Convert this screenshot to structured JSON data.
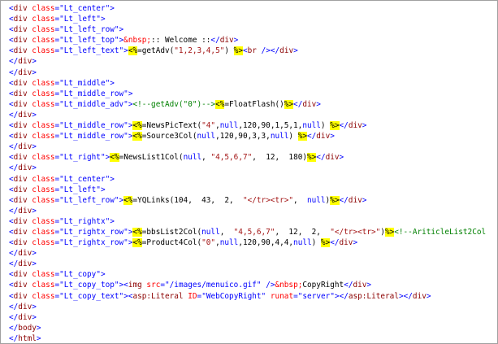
{
  "colors": {
    "tag": "#8b0000",
    "bracket": "#0000ff",
    "attribute": "#ff0000",
    "string": "#0000ff",
    "entity": "#ff0000",
    "comment": "#008000",
    "asp_delimiter_bg": "#ffff00"
  },
  "lines": [
    [
      [
        "brk",
        "<"
      ],
      [
        "tag",
        "div"
      ],
      [
        "text",
        " "
      ],
      [
        "attr",
        "class"
      ],
      [
        "eq",
        "="
      ],
      [
        "str",
        "\"Lt_center\""
      ],
      [
        "brk",
        ">"
      ]
    ],
    [
      [
        "brk",
        "<"
      ],
      [
        "tag",
        "div"
      ],
      [
        "text",
        " "
      ],
      [
        "attr",
        "class"
      ],
      [
        "eq",
        "="
      ],
      [
        "str",
        "\"Lt_left\""
      ],
      [
        "brk",
        ">"
      ]
    ],
    [
      [
        "brk",
        "<"
      ],
      [
        "tag",
        "div"
      ],
      [
        "text",
        " "
      ],
      [
        "attr",
        "class"
      ],
      [
        "eq",
        "="
      ],
      [
        "str",
        "\"Lt_left_row\""
      ],
      [
        "brk",
        ">"
      ]
    ],
    [
      [
        "brk",
        "<"
      ],
      [
        "tag",
        "div"
      ],
      [
        "text",
        " "
      ],
      [
        "attr",
        "class"
      ],
      [
        "eq",
        "="
      ],
      [
        "str",
        "\"Lt_left_top\""
      ],
      [
        "brk",
        ">"
      ],
      [
        "ent",
        "&nbsp;"
      ],
      [
        "text",
        ":: Welcome ::"
      ],
      [
        "brk",
        "</"
      ],
      [
        "tag",
        "div"
      ],
      [
        "brk",
        ">"
      ]
    ],
    [
      [
        "brk",
        "<"
      ],
      [
        "tag",
        "div"
      ],
      [
        "text",
        " "
      ],
      [
        "attr",
        "class"
      ],
      [
        "eq",
        "="
      ],
      [
        "str",
        "\"Lt_left_text\""
      ],
      [
        "brk",
        ">"
      ],
      [
        "asp",
        "<%"
      ],
      [
        "code",
        "=getAdv("
      ],
      [
        "cstr",
        "\"1,2,3,4,5\""
      ],
      [
        "code",
        ") "
      ],
      [
        "asp",
        "%>"
      ],
      [
        "brk",
        "<"
      ],
      [
        "tag",
        "br"
      ],
      [
        "text",
        " "
      ],
      [
        "brk",
        "/>"
      ],
      [
        "brk",
        "</"
      ],
      [
        "tag",
        "div"
      ],
      [
        "brk",
        ">"
      ]
    ],
    [
      [
        "brk",
        "</"
      ],
      [
        "tag",
        "div"
      ],
      [
        "brk",
        ">"
      ]
    ],
    [
      [
        "brk",
        "</"
      ],
      [
        "tag",
        "div"
      ],
      [
        "brk",
        ">"
      ]
    ],
    [
      [
        "brk",
        "<"
      ],
      [
        "tag",
        "div"
      ],
      [
        "text",
        " "
      ],
      [
        "attr",
        "class"
      ],
      [
        "eq",
        "="
      ],
      [
        "str",
        "\"Lt_middle\""
      ],
      [
        "brk",
        ">"
      ]
    ],
    [
      [
        "brk",
        "<"
      ],
      [
        "tag",
        "div"
      ],
      [
        "text",
        " "
      ],
      [
        "attr",
        "class"
      ],
      [
        "eq",
        "="
      ],
      [
        "str",
        "\"Lt_middle_row\""
      ],
      [
        "brk",
        ">"
      ]
    ],
    [
      [
        "brk",
        "<"
      ],
      [
        "tag",
        "div"
      ],
      [
        "text",
        " "
      ],
      [
        "attr",
        "class"
      ],
      [
        "eq",
        "="
      ],
      [
        "str",
        "\"Lt_middle_adv\""
      ],
      [
        "brk",
        ">"
      ],
      [
        "cmt",
        "<!--getAdv(\"0\")-->"
      ],
      [
        "asp",
        "<%"
      ],
      [
        "code",
        "=FloatFlash()"
      ],
      [
        "asp",
        "%>"
      ],
      [
        "brk",
        "</"
      ],
      [
        "tag",
        "div"
      ],
      [
        "brk",
        ">"
      ]
    ],
    [
      [
        "brk",
        "</"
      ],
      [
        "tag",
        "div"
      ],
      [
        "brk",
        ">"
      ]
    ],
    [
      [
        "brk",
        "<"
      ],
      [
        "tag",
        "div"
      ],
      [
        "text",
        " "
      ],
      [
        "attr",
        "class"
      ],
      [
        "eq",
        "="
      ],
      [
        "str",
        "\"Lt_middle_row\""
      ],
      [
        "brk",
        ">"
      ],
      [
        "asp",
        "<%"
      ],
      [
        "code",
        "=NewsPicText("
      ],
      [
        "cstr",
        "\"4\""
      ],
      [
        "code",
        ","
      ],
      [
        "kw",
        "null"
      ],
      [
        "code",
        ",120,90,1,5,1,"
      ],
      [
        "kw",
        "null"
      ],
      [
        "code",
        ") "
      ],
      [
        "asp",
        "%>"
      ],
      [
        "brk",
        "</"
      ],
      [
        "tag",
        "div"
      ],
      [
        "brk",
        ">"
      ]
    ],
    [
      [
        "brk",
        "<"
      ],
      [
        "tag",
        "div"
      ],
      [
        "text",
        " "
      ],
      [
        "attr",
        "class"
      ],
      [
        "eq",
        "="
      ],
      [
        "str",
        "\"Lt_middle_row\""
      ],
      [
        "brk",
        ">"
      ],
      [
        "asp",
        "<%"
      ],
      [
        "code",
        "=Source3Col("
      ],
      [
        "kw",
        "null"
      ],
      [
        "code",
        ",120,90,3,3,"
      ],
      [
        "kw",
        "null"
      ],
      [
        "code",
        ") "
      ],
      [
        "asp",
        "%>"
      ],
      [
        "brk",
        "</"
      ],
      [
        "tag",
        "div"
      ],
      [
        "brk",
        ">"
      ]
    ],
    [
      [
        "brk",
        "</"
      ],
      [
        "tag",
        "div"
      ],
      [
        "brk",
        ">"
      ]
    ],
    [
      [
        "brk",
        "<"
      ],
      [
        "tag",
        "div"
      ],
      [
        "text",
        " "
      ],
      [
        "attr",
        "class"
      ],
      [
        "eq",
        "="
      ],
      [
        "str",
        "\"Lt_right\""
      ],
      [
        "brk",
        ">"
      ],
      [
        "asp",
        "<%"
      ],
      [
        "code",
        "=NewsList1Col("
      ],
      [
        "kw",
        "null"
      ],
      [
        "code",
        ", "
      ],
      [
        "cstr",
        "\"4,5,6,7\""
      ],
      [
        "code",
        ",  12,  180)"
      ],
      [
        "asp",
        "%>"
      ],
      [
        "brk",
        "</"
      ],
      [
        "tag",
        "div"
      ],
      [
        "brk",
        ">"
      ]
    ],
    [
      [
        "brk",
        "</"
      ],
      [
        "tag",
        "div"
      ],
      [
        "brk",
        ">"
      ]
    ],
    [
      [
        "brk",
        "<"
      ],
      [
        "tag",
        "div"
      ],
      [
        "text",
        " "
      ],
      [
        "attr",
        "class"
      ],
      [
        "eq",
        "="
      ],
      [
        "str",
        "\"Lt_center\""
      ],
      [
        "brk",
        ">"
      ]
    ],
    [
      [
        "brk",
        "<"
      ],
      [
        "tag",
        "div"
      ],
      [
        "text",
        " "
      ],
      [
        "attr",
        "class"
      ],
      [
        "eq",
        "="
      ],
      [
        "str",
        "\"Lt_left\""
      ],
      [
        "brk",
        ">"
      ]
    ],
    [
      [
        "brk",
        "<"
      ],
      [
        "tag",
        "div"
      ],
      [
        "text",
        " "
      ],
      [
        "attr",
        "class"
      ],
      [
        "eq",
        "="
      ],
      [
        "str",
        "\"Lt_left_row\""
      ],
      [
        "brk",
        ">"
      ],
      [
        "asp",
        "<%"
      ],
      [
        "code",
        "=YQLinks(104,  43,  2,  "
      ],
      [
        "cstr",
        "\"</tr><tr>\""
      ],
      [
        "code",
        ",  "
      ],
      [
        "kw",
        "null"
      ],
      [
        "code",
        ")"
      ],
      [
        "asp",
        "%>"
      ],
      [
        "brk",
        "</"
      ],
      [
        "tag",
        "div"
      ],
      [
        "brk",
        ">"
      ]
    ],
    [
      [
        "brk",
        "</"
      ],
      [
        "tag",
        "div"
      ],
      [
        "brk",
        ">"
      ]
    ],
    [
      [
        "brk",
        "<"
      ],
      [
        "tag",
        "div"
      ],
      [
        "text",
        " "
      ],
      [
        "attr",
        "class"
      ],
      [
        "eq",
        "="
      ],
      [
        "str",
        "\"Lt_rightx\""
      ],
      [
        "brk",
        ">"
      ]
    ],
    [
      [
        "brk",
        "<"
      ],
      [
        "tag",
        "div"
      ],
      [
        "text",
        " "
      ],
      [
        "attr",
        "class"
      ],
      [
        "eq",
        "="
      ],
      [
        "str",
        "\"Lt_rightx_row\""
      ],
      [
        "brk",
        ">"
      ],
      [
        "asp",
        "<%"
      ],
      [
        "code",
        "=bbsList2Col("
      ],
      [
        "kw",
        "null"
      ],
      [
        "code",
        ",  "
      ],
      [
        "cstr",
        "\"4,5,6,7\""
      ],
      [
        "code",
        ",  12,  2,  "
      ],
      [
        "cstr",
        "\"</tr><tr>\""
      ],
      [
        "code",
        ")"
      ],
      [
        "asp",
        "%>"
      ],
      [
        "cmt",
        "<!--AriticleList2Col"
      ]
    ],
    [
      [
        "brk",
        "<"
      ],
      [
        "tag",
        "div"
      ],
      [
        "text",
        " "
      ],
      [
        "attr",
        "class"
      ],
      [
        "eq",
        "="
      ],
      [
        "str",
        "\"Lt_rightx_row\""
      ],
      [
        "brk",
        ">"
      ],
      [
        "asp",
        "<%"
      ],
      [
        "code",
        "=Product4Col("
      ],
      [
        "cstr",
        "\"0\""
      ],
      [
        "code",
        ","
      ],
      [
        "kw",
        "null"
      ],
      [
        "code",
        ",120,90,4,4,"
      ],
      [
        "kw",
        "null"
      ],
      [
        "code",
        ") "
      ],
      [
        "asp",
        "%>"
      ],
      [
        "brk",
        "</"
      ],
      [
        "tag",
        "div"
      ],
      [
        "brk",
        ">"
      ]
    ],
    [
      [
        "brk",
        "</"
      ],
      [
        "tag",
        "div"
      ],
      [
        "brk",
        ">"
      ]
    ],
    [
      [
        "brk",
        "</"
      ],
      [
        "tag",
        "div"
      ],
      [
        "brk",
        ">"
      ]
    ],
    [
      [
        "brk",
        "<"
      ],
      [
        "tag",
        "div"
      ],
      [
        "text",
        " "
      ],
      [
        "attr",
        "class"
      ],
      [
        "eq",
        "="
      ],
      [
        "str",
        "\"Lt_copy\""
      ],
      [
        "brk",
        ">"
      ]
    ],
    [
      [
        "brk",
        "<"
      ],
      [
        "tag",
        "div"
      ],
      [
        "text",
        " "
      ],
      [
        "attr",
        "class"
      ],
      [
        "eq",
        "="
      ],
      [
        "str",
        "\"Lt_copy_top\""
      ],
      [
        "brk",
        ">"
      ],
      [
        "brk",
        "<"
      ],
      [
        "tag",
        "img"
      ],
      [
        "text",
        " "
      ],
      [
        "attr",
        "src"
      ],
      [
        "eq",
        "="
      ],
      [
        "str",
        "\"/images/menuico.gif\""
      ],
      [
        "text",
        " "
      ],
      [
        "brk",
        "/>"
      ],
      [
        "ent",
        "&nbsp;"
      ],
      [
        "text",
        "CopyRight"
      ],
      [
        "brk",
        "</"
      ],
      [
        "tag",
        "div"
      ],
      [
        "brk",
        ">"
      ]
    ],
    [
      [
        "brk",
        "<"
      ],
      [
        "tag",
        "div"
      ],
      [
        "text",
        " "
      ],
      [
        "attr",
        "class"
      ],
      [
        "eq",
        "="
      ],
      [
        "str",
        "\"Lt_copy_text\""
      ],
      [
        "brk",
        ">"
      ],
      [
        "brk",
        "<"
      ],
      [
        "tag",
        "asp:Literal"
      ],
      [
        "text",
        " "
      ],
      [
        "attr",
        "ID"
      ],
      [
        "eq",
        "="
      ],
      [
        "str",
        "\"WebCopyRight\""
      ],
      [
        "text",
        " "
      ],
      [
        "attr",
        "runat"
      ],
      [
        "eq",
        "="
      ],
      [
        "str",
        "\"server\""
      ],
      [
        "brk",
        ">"
      ],
      [
        "brk",
        "</"
      ],
      [
        "tag",
        "asp:Literal"
      ],
      [
        "brk",
        ">"
      ],
      [
        "brk",
        "</"
      ],
      [
        "tag",
        "div"
      ],
      [
        "brk",
        ">"
      ]
    ],
    [
      [
        "brk",
        "</"
      ],
      [
        "tag",
        "div"
      ],
      [
        "brk",
        ">"
      ]
    ],
    [
      [
        "brk",
        "</"
      ],
      [
        "tag",
        "div"
      ],
      [
        "brk",
        ">"
      ]
    ],
    [
      [
        "brk",
        "</"
      ],
      [
        "tag",
        "body"
      ],
      [
        "brk",
        ">"
      ]
    ],
    [
      [
        "brk",
        "</"
      ],
      [
        "tag",
        "html"
      ],
      [
        "brk",
        ">"
      ]
    ]
  ]
}
